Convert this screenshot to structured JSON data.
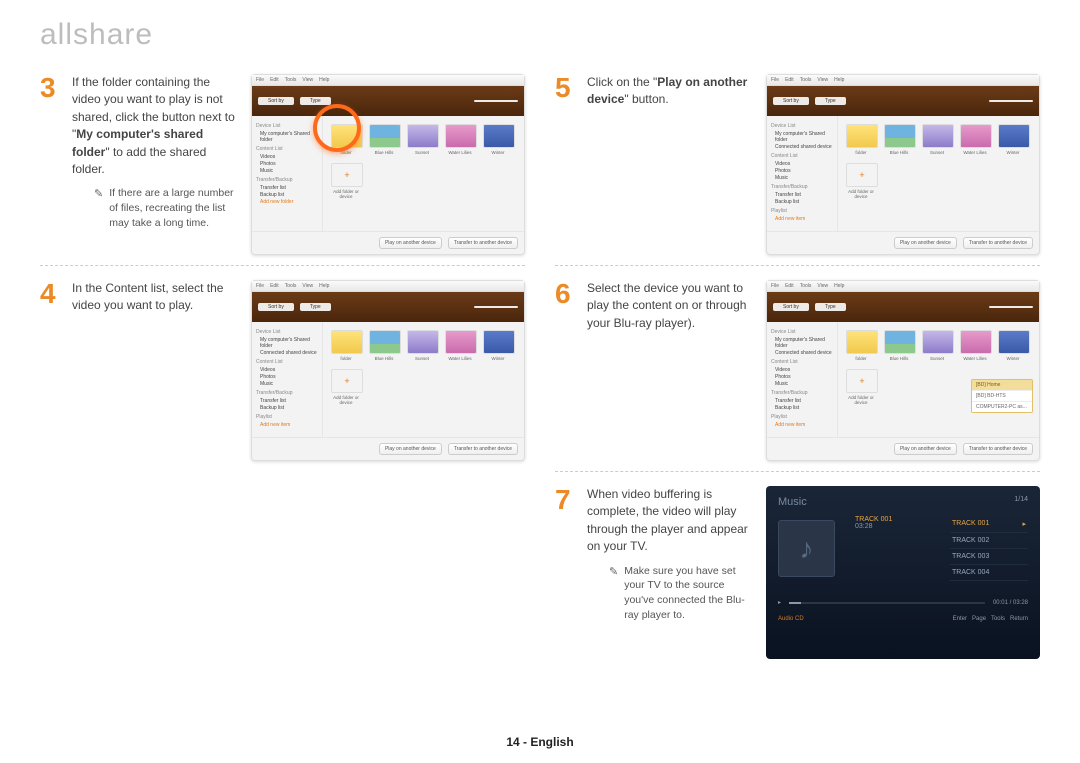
{
  "logo": "allshare",
  "page_footer": "14 - English",
  "left": {
    "step3": {
      "num": "3",
      "pre": "If the folder containing the video you want to play is not shared, click the button next to \"",
      "bold": "My computer's shared folder",
      "post": "\" to add the shared folder.",
      "note": "If there are a large number of files, recreating the list may take a long time."
    },
    "step4": {
      "num": "4",
      "text": "In the Content list, select the video you want to play."
    }
  },
  "right": {
    "step5": {
      "num": "5",
      "pre": "Click on the \"",
      "bold": "Play on another device",
      "post": "\" button."
    },
    "step6": {
      "num": "6",
      "text": "Select the device you want to play the content on or through your Blu-ray player)."
    },
    "step7": {
      "num": "7",
      "text": "When video buffering is complete, the video will play through the player and appear on your TV.",
      "note": "Make sure you have set your TV to the source you've connected the Blu-ray player to."
    }
  },
  "win": {
    "menu": {
      "file": "File",
      "edit": "Edit",
      "tools": "Tools",
      "view": "View",
      "help": "Help"
    },
    "toolbar": {
      "sort": "Sort by",
      "type": "Type"
    },
    "side": {
      "device_list": "Device List",
      "my_shared": "My computer's Shared folder",
      "connected": "Connected shared device",
      "content_list": "Content List",
      "videos": "Videos",
      "photos": "Photos",
      "music": "Music",
      "transfer_backup": "Transfer/Backup",
      "transfer_list": "Transfer list",
      "backup_list": "Backup list",
      "playlist": "Playlist",
      "add_new": "Add new folder",
      "add_item": "Add new item"
    },
    "thumbs": {
      "folder": "folder",
      "blue": "Blue Hills",
      "mount": "Sunset",
      "pink": "Water Lilies",
      "winter": "Winter",
      "add": "Add folder or device"
    },
    "footer": {
      "play": "Play on another device",
      "transfer": "Transfer to another device"
    },
    "popup": {
      "header": "[BD] Home",
      "i1": "[BD] BD-HTS",
      "i2": "COMPUTER2-PC as..."
    }
  },
  "tv": {
    "title": "Music",
    "count": "1/14",
    "current": {
      "track": "TRACK 001",
      "time": "03:28"
    },
    "tracks": [
      "TRACK 001",
      "TRACK 002",
      "TRACK 003",
      "TRACK 004"
    ],
    "progress": "00:01 / 03:28",
    "src": "Audio CD",
    "controls": {
      "enter": "Enter",
      "page": "Page",
      "tools": "Tools",
      "return": "Return"
    }
  }
}
